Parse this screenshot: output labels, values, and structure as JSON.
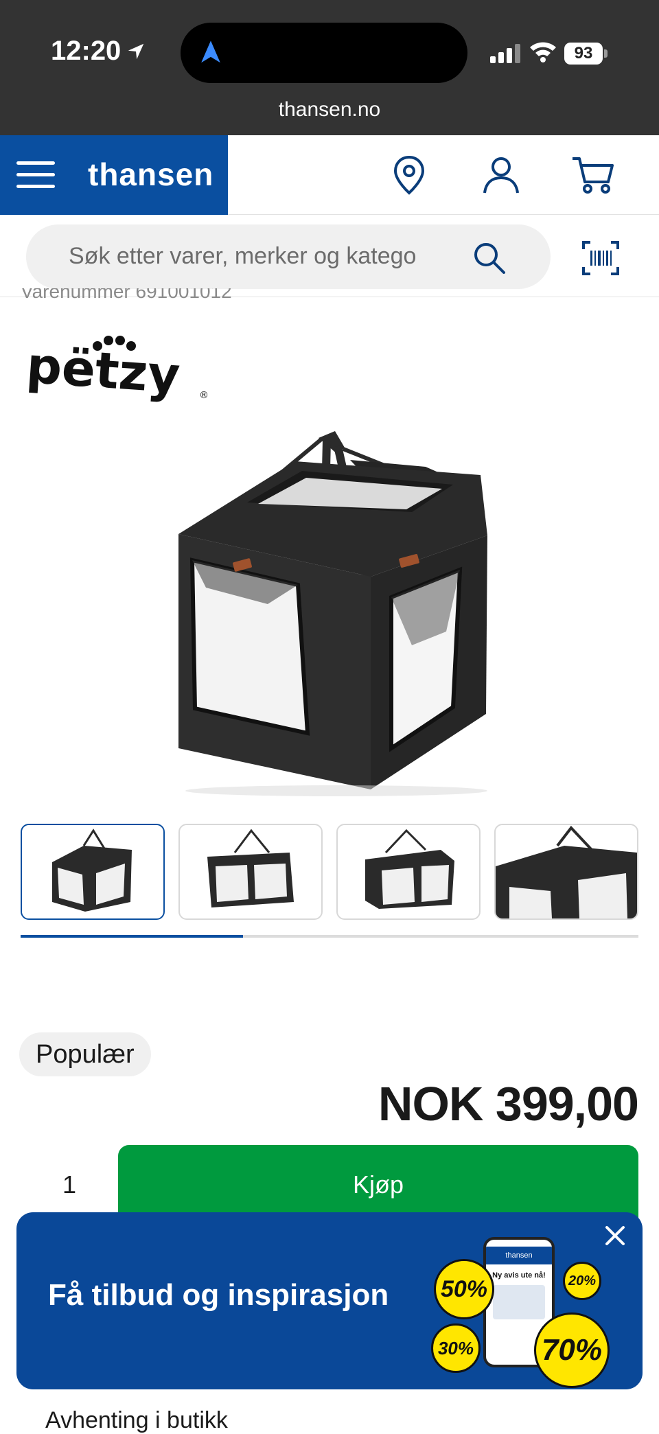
{
  "status_bar": {
    "time": "12:20",
    "battery": "93",
    "url": "thansen.no"
  },
  "header": {
    "logo": "thansen"
  },
  "search": {
    "placeholder": "Søk etter varer, merker og katego"
  },
  "product": {
    "varenummer": "Varenummer 691001012",
    "brand_logo": "pëtzy",
    "badge": "Populær",
    "price": "NOK 399,00",
    "quantity": "1",
    "buy_label": "Kjøp",
    "gallery_progress": 0.36
  },
  "banner": {
    "text": "Få tilbud og inspirasjon",
    "phone_logo": "thansen",
    "phone_title": "Ny avis ute nå!",
    "discounts": [
      "50%",
      "20%",
      "30%",
      "70%"
    ]
  },
  "bottom": {
    "text": "Avhenting i butikk"
  },
  "colors": {
    "brand": "#0a4fa0",
    "buy": "#009a3e",
    "banner": "#0a4898",
    "status_bar": "#333333"
  }
}
